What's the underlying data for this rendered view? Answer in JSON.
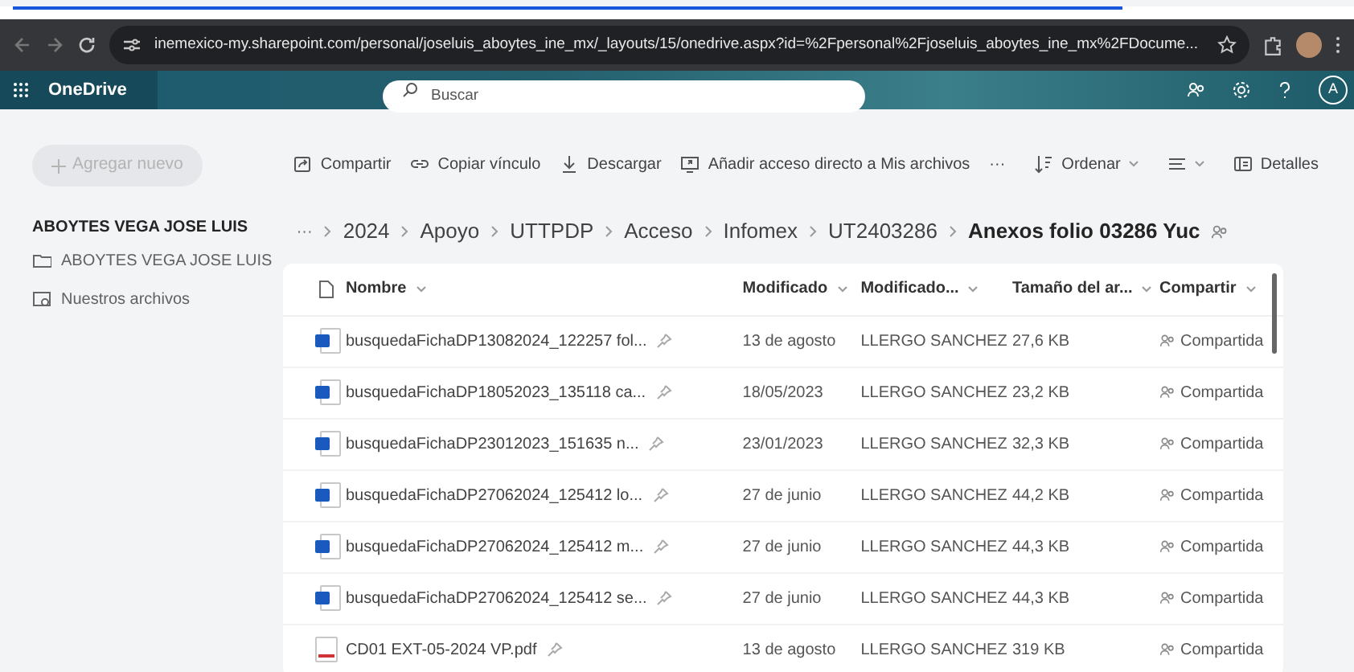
{
  "browser": {
    "url": "inemexico-my.sharepoint.com/personal/joseluis_aboytes_ine_mx/_layouts/15/onedrive.aspx?id=%2Fpersonal%2Fjoseluis_aboytes_ine_mx%2FDocume..."
  },
  "app": {
    "title": "OneDrive",
    "search_placeholder": "Buscar",
    "avatar": "A"
  },
  "sidebar": {
    "new_button": "Agregar nuevo",
    "new_button_disabled": true,
    "heading": "ABOYTES VEGA JOSE LUIS",
    "items": [
      {
        "label": "ABOYTES VEGA JOSE LUIS",
        "kind": "folder"
      },
      {
        "label": "Nuestros archivos",
        "kind": "shared"
      }
    ]
  },
  "toolbar": {
    "actions": [
      {
        "label": "Compartir",
        "kind": "share"
      },
      {
        "label": "Copiar vínculo",
        "kind": "link"
      },
      {
        "label": "Descargar",
        "kind": "download"
      },
      {
        "label": "Añadir acceso directo a Mis archivos",
        "kind": "shortcut"
      },
      {
        "label": "···",
        "kind": "more"
      }
    ],
    "right": [
      {
        "label": "Ordenar",
        "kind": "sort"
      },
      {
        "kind": "view"
      },
      {
        "label": "Detalles",
        "kind": "details"
      }
    ]
  },
  "breadcrumb": {
    "more": "···",
    "items": [
      "2024",
      "Apoyo",
      "UTTPDP",
      "Acceso",
      "Infomex",
      "UT2403286",
      "Anexos folio 03286 Yuc"
    ]
  },
  "table": {
    "columns": [
      "Nombre",
      "Modificado",
      "Modificado...",
      "Tamaño del ar...",
      "Compartir"
    ],
    "rows": [
      {
        "kind": "word",
        "name": "busquedaFichaDP13082024_122257 fol...",
        "modified": "13 de agosto",
        "modified_by": "LLERGO SANCHEZ",
        "size": "27,6 KB",
        "sharing": "Compartida"
      },
      {
        "kind": "word",
        "name": "busquedaFichaDP18052023_135118 ca...",
        "modified": "18/05/2023",
        "modified_by": "LLERGO SANCHEZ",
        "size": "23,2 KB",
        "sharing": "Compartida"
      },
      {
        "kind": "word",
        "name": "busquedaFichaDP23012023_151635 n...",
        "modified": "23/01/2023",
        "modified_by": "LLERGO SANCHEZ",
        "size": "32,3 KB",
        "sharing": "Compartida"
      },
      {
        "kind": "word",
        "name": "busquedaFichaDP27062024_125412 lo...",
        "modified": "27 de junio",
        "modified_by": "LLERGO SANCHEZ",
        "size": "44,2 KB",
        "sharing": "Compartida"
      },
      {
        "kind": "word",
        "name": "busquedaFichaDP27062024_125412 m...",
        "modified": "27 de junio",
        "modified_by": "LLERGO SANCHEZ",
        "size": "44,3 KB",
        "sharing": "Compartida"
      },
      {
        "kind": "word",
        "name": "busquedaFichaDP27062024_125412 se...",
        "modified": "27 de junio",
        "modified_by": "LLERGO SANCHEZ",
        "size": "44,3 KB",
        "sharing": "Compartida"
      },
      {
        "kind": "pdf",
        "name": "CD01 EXT-05-2024 VP.pdf",
        "modified": "13 de agosto",
        "modified_by": "LLERGO SANCHEZ",
        "size": "319 KB",
        "sharing": "Compartida"
      }
    ]
  }
}
